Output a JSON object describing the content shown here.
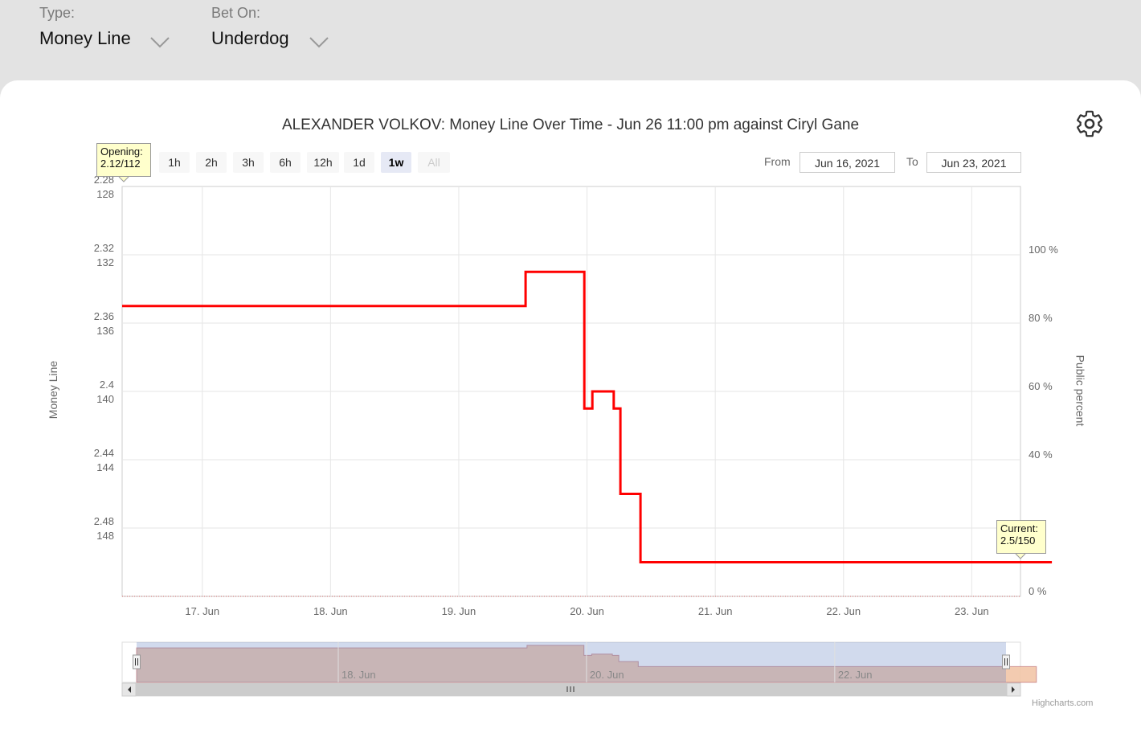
{
  "filters": {
    "type_label": "Type:",
    "type_value": "Money Line",
    "bet_label": "Bet On:",
    "bet_value": "Underdog"
  },
  "chart_data": {
    "type": "line",
    "title": "ALEXANDER VOLKOV: Money Line Over Time - Jun 26 11:00 pm against Ciryl Gane",
    "ylabel": "Money Line",
    "y2label": "Public percent",
    "x_ticks": [
      "17. Jun",
      "18. Jun",
      "19. Jun",
      "20. Jun",
      "21. Jun",
      "22. Jun",
      "23. Jun"
    ],
    "navigator_ticks": [
      "18. Jun",
      "20. Jun",
      "22. Jun"
    ],
    "y_left_ticks": [
      {
        "decimal": "2.28",
        "american": "128"
      },
      {
        "decimal": "2.32",
        "american": "132"
      },
      {
        "decimal": "2.36",
        "american": "136"
      },
      {
        "decimal": "2.4",
        "american": "140"
      },
      {
        "decimal": "2.44",
        "american": "144"
      },
      {
        "decimal": "2.48",
        "american": "148"
      }
    ],
    "y_right_ticks": [
      "100 %",
      "80 %",
      "60 %",
      "40 %",
      "",
      "0 %"
    ],
    "ylim": [
      128,
      152
    ],
    "y_reversed": true,
    "grid": true,
    "series": [
      {
        "color": "#ff0000",
        "step": true,
        "points": [
          {
            "x": "2021-06-16 09:00",
            "y": 135
          },
          {
            "x": "2021-06-19 12:30",
            "y": 135
          },
          {
            "x": "2021-06-19 12:30",
            "y": 133
          },
          {
            "x": "2021-06-19 23:30",
            "y": 133
          },
          {
            "x": "2021-06-19 23:30",
            "y": 141
          },
          {
            "x": "2021-06-20 01:00",
            "y": 141
          },
          {
            "x": "2021-06-20 01:00",
            "y": 140
          },
          {
            "x": "2021-06-20 05:00",
            "y": 140
          },
          {
            "x": "2021-06-20 05:00",
            "y": 141
          },
          {
            "x": "2021-06-20 06:15",
            "y": 141
          },
          {
            "x": "2021-06-20 06:15",
            "y": 146
          },
          {
            "x": "2021-06-20 10:00",
            "y": 146
          },
          {
            "x": "2021-06-20 10:00",
            "y": 150
          },
          {
            "x": "2021-06-23 15:00",
            "y": 150
          }
        ]
      }
    ],
    "opening_tooltip": [
      "Opening:",
      "2.12/112"
    ],
    "current_tooltip": [
      "Current:",
      "2.5/150"
    ]
  },
  "toolbar": {
    "zoom_buttons": [
      {
        "label": "1h",
        "active": false
      },
      {
        "label": "2h",
        "active": false
      },
      {
        "label": "3h",
        "active": false
      },
      {
        "label": "6h",
        "active": false
      },
      {
        "label": "12h",
        "active": false
      },
      {
        "label": "1d",
        "active": false
      },
      {
        "label": "1w",
        "active": true
      },
      {
        "label": "All",
        "disabled": true
      }
    ],
    "from_label": "From",
    "from_value": "Jun 16, 2021",
    "to_label": "To",
    "to_value": "Jun 23, 2021"
  },
  "credit": "Highcharts.com",
  "icons": {
    "settings": "gear-icon",
    "dropdown": "chevron-down-icon"
  }
}
